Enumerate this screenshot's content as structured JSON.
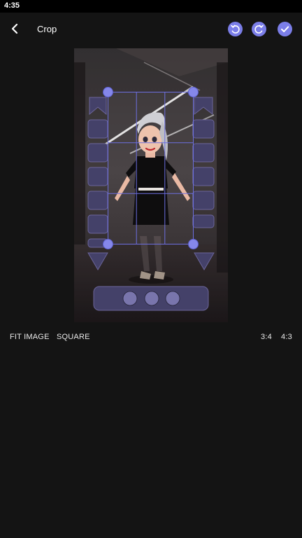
{
  "status_bar": {
    "time": "4:35"
  },
  "toolbar": {
    "title": "Crop",
    "accent_color": "#7b7ee8"
  },
  "icons": {
    "back": "arrow-left-icon",
    "undo": "rotate-left-icon",
    "redo": "rotate-right-icon",
    "done": "check-icon"
  },
  "crop_options": {
    "fit_image": "FIT IMAGE",
    "square": "SQUARE",
    "ratio_3_4": "3:4",
    "ratio_4_3": "4:3"
  }
}
